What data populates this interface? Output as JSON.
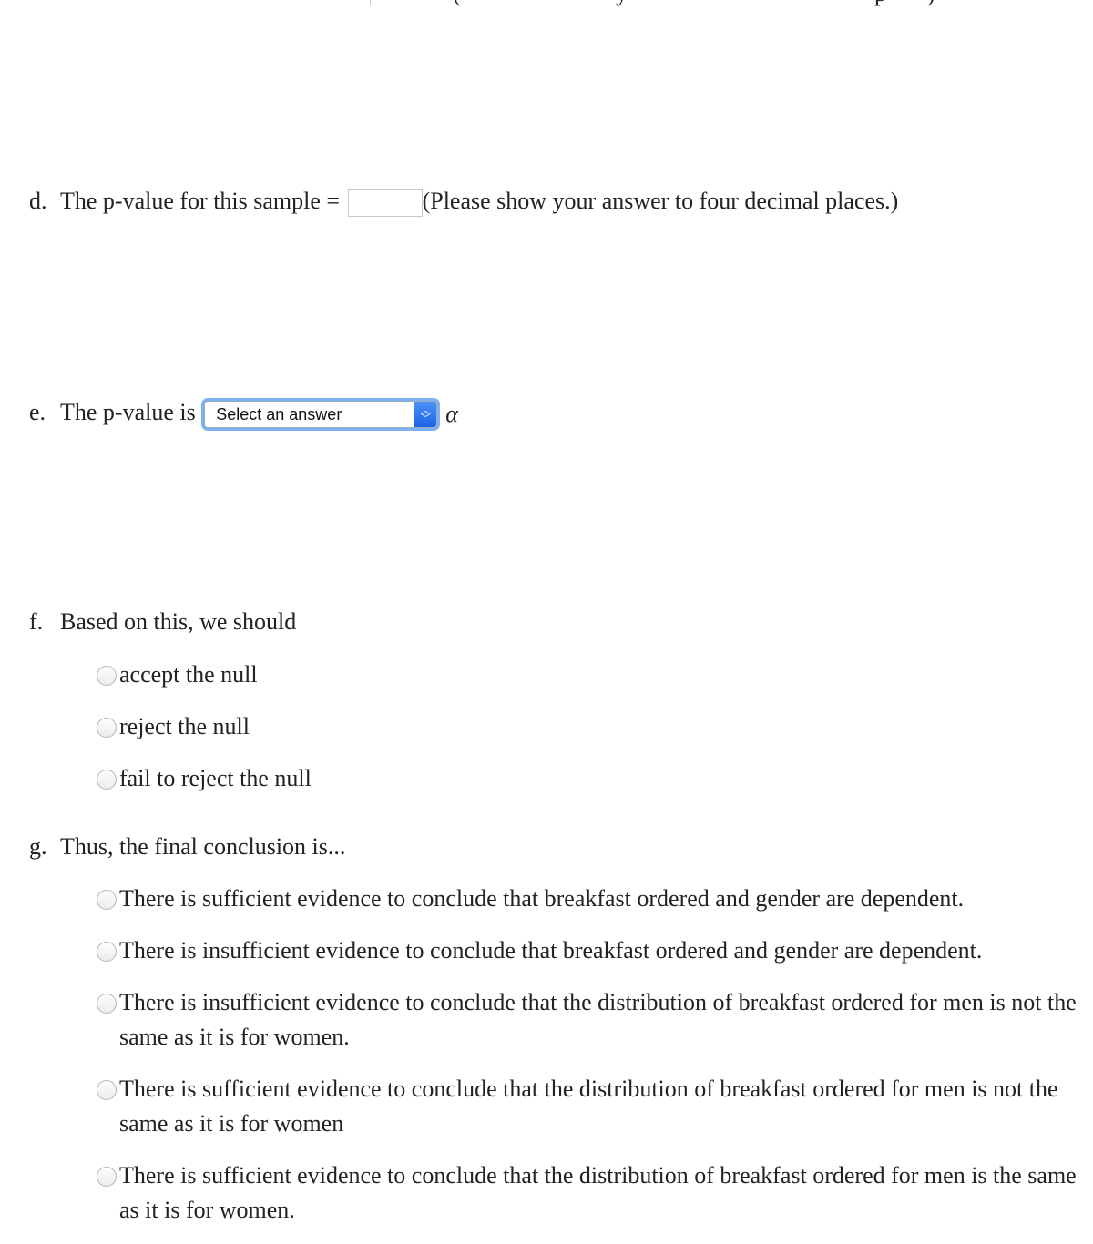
{
  "top_fragment": {
    "paren_open": "(",
    "glyph_a": "y",
    "glyph_b": "p",
    "paren_close": ")"
  },
  "question_d": {
    "label": "d.",
    "text": "The p-value for this sample =",
    "input_value": "",
    "hint": "(Please show your answer to four decimal places.)"
  },
  "question_e": {
    "label": "e.",
    "text": "The p-value is",
    "select_value": "Select an answer",
    "symbol": "α"
  },
  "question_f": {
    "label": "f.",
    "text": "Based on this, we should",
    "options": [
      "accept the null",
      "reject the null",
      "fail to reject the null"
    ]
  },
  "question_g": {
    "label": "g.",
    "text": "Thus, the final conclusion is...",
    "options": [
      "There is sufficient evidence to conclude that breakfast ordered and gender are dependent.",
      "There is insufficient evidence to conclude that breakfast ordered and gender are dependent.",
      "There is insufficient evidence to conclude that the distribution of breakfast ordered for men is not the same as it is for women.",
      "There is sufficient evidence to conclude that the distribution of breakfast ordered for men is not the same as it is for women",
      "There is sufficient evidence to conclude that the distribution of breakfast ordered for men is the same as it is for women."
    ]
  }
}
